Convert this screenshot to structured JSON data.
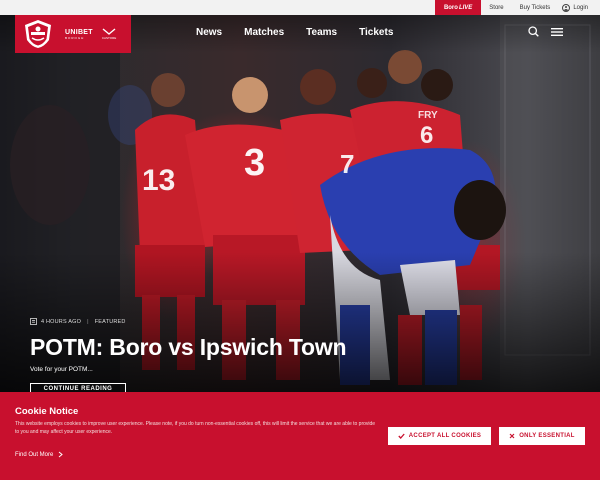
{
  "util_bar": {
    "live_label": "Boro",
    "live_suffix": "LIVE",
    "store_label": "Store",
    "tickets_label": "Buy Tickets",
    "login_label": "Login"
  },
  "brand": {
    "sponsor_name": "UNIBET",
    "sponsor_tag": "BOROGH",
    "sponsor2_name": "CASTORE"
  },
  "nav": {
    "items": [
      "News",
      "Matches",
      "Teams",
      "Tickets"
    ]
  },
  "hero": {
    "time_ago": "4 HOURS AGO",
    "tag": "FEATURED",
    "headline": "POTM: Boro vs Ipswich Town",
    "subtitle": "Vote for your POTM...",
    "cta_label": "CONTINUE READING",
    "shirt_numbers": [
      "13",
      "3",
      "7",
      "6"
    ],
    "shirt_name": "FRY"
  },
  "cookie": {
    "title": "Cookie Notice",
    "text": "This website employs cookies to improve user experience. Please note, if you do turn non-essential cookies off, this will limit the service that we are able to provide to you and may affect your user experience.",
    "find_out_more": "Find Out More",
    "accept_label": "ACCEPT ALL COOKIES",
    "essential_label": "ONLY ESSENTIAL"
  },
  "colors": {
    "brand_red": "#c8102e",
    "util_bg": "#f2f2f2",
    "cookie_text": "#f3dede"
  }
}
